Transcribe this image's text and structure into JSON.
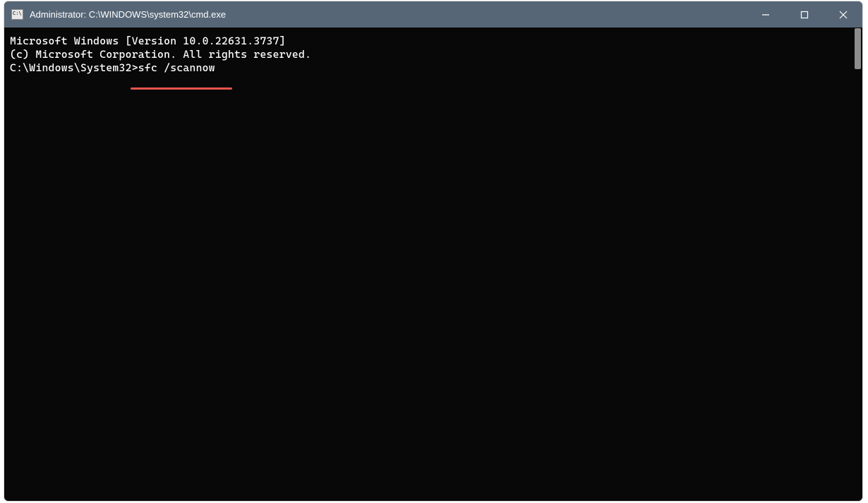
{
  "window": {
    "title": "Administrator: C:\\WINDOWS\\system32\\cmd.exe"
  },
  "terminal": {
    "line1": "Microsoft Windows [Version 10.0.22631.3737]",
    "line2": "(c) Microsoft Corporation. All rights reserved.",
    "blank": "",
    "prompt_prefix": "C:\\Windows\\System32>",
    "command": "sfc /scannow"
  },
  "annotation": {
    "underline_color": "#e8554d"
  }
}
